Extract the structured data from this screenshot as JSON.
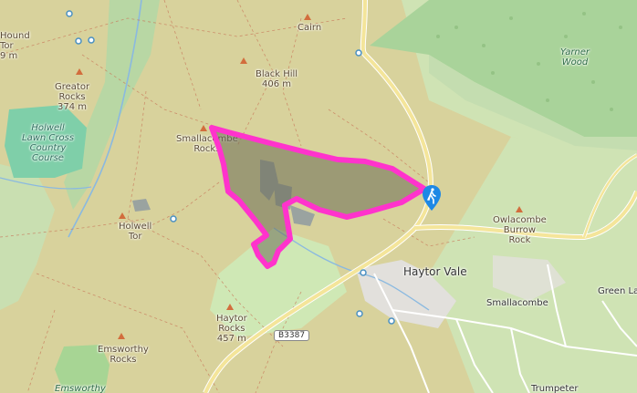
{
  "map": {
    "labels": {
      "hound_tor": "Hound\nTor\n9 m",
      "greator_rocks": "Greator\nRocks\n374 m",
      "holwell_lawn": "Holwell\nLawn Cross\nCountry\nCourse",
      "cairn": "Cairn",
      "black_hill": "Black Hill\n406 m",
      "smallacombe_rocks": "Smallacombe\nRocks",
      "holwell_tor": "Holwell\nTor",
      "yarner_wood": "Yarner\nWood",
      "owlacombe": "Owlacombe\nBurrow\nRock",
      "haytor_vale": "Haytor Vale",
      "smallacombe": "Smallacombe",
      "green_lane": "Green La",
      "haytor_rocks": "Haytor\nRocks\n457 m",
      "emsworthy_rocks": "Emsworthy\nRocks",
      "emsworthy": "Emsworthy",
      "trumpeter": "Trumpeter"
    },
    "road_ref": "B3387",
    "route_color": "#ff33cc",
    "area_fill": "#6b6b55",
    "marker_icon": "hiker-icon",
    "marker_color": "#1e88e5"
  }
}
